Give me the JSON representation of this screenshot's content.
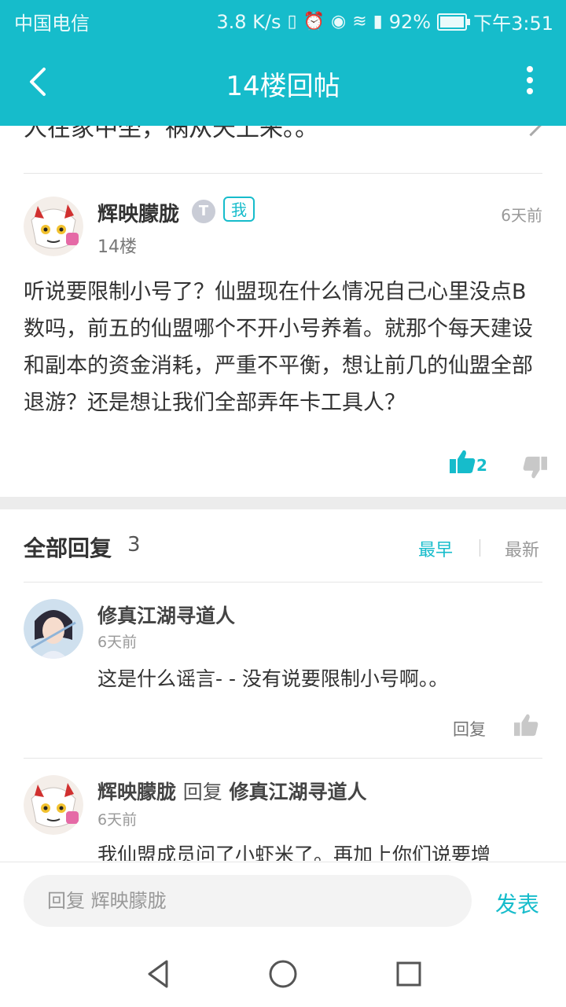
{
  "status": {
    "carrier": "中国电信",
    "speed": "3.8 K/s",
    "battery": "92%",
    "time": "下午3:51"
  },
  "header": {
    "title": "14楼回帖"
  },
  "prev_text": "人在家中坐，祸从天上来。。",
  "post": {
    "user": "辉映朦胧",
    "me_badge": "我",
    "badge_letter": "T",
    "floor": "14楼",
    "time": "6天前",
    "body": "听说要限制小号了？仙盟现在什么情况自己心里没点B数吗，前五的仙盟哪个不开小号养着。就那个每天建设和副本的资金消耗，严重不平衡，想让前几的仙盟全部退游？还是想让我们全部弄年卡工具人？",
    "likes": "2"
  },
  "replies": {
    "heading": "全部回复",
    "count": "3",
    "sort_early": "最早",
    "sort_new": "最新",
    "items": [
      {
        "user": "修真江湖寻道人",
        "time": "6天前",
        "body": "这是什么谣言- - 没有说要限制小号啊。。",
        "reply_label": "回复"
      },
      {
        "user": "辉映朦胧",
        "reply_word": "回复",
        "reply_to": "修真江湖寻道人",
        "time": "6天前",
        "body": "我仙盟成员问了小虾米了。再加上你们说要增"
      }
    ]
  },
  "composer": {
    "placeholder": "回复 辉映朦胧",
    "submit": "发表"
  },
  "colors": {
    "accent": "#16bccb"
  }
}
